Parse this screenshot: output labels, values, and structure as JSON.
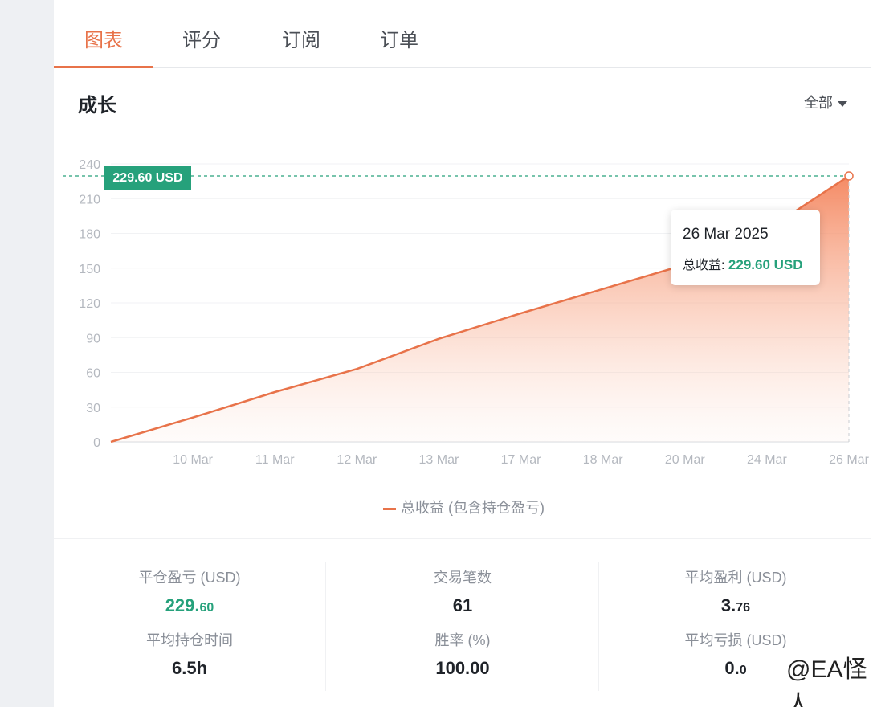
{
  "tabs": [
    {
      "label": "图表",
      "active": true
    },
    {
      "label": "评分",
      "active": false
    },
    {
      "label": "订阅",
      "active": false
    },
    {
      "label": "订单",
      "active": false
    }
  ],
  "section": {
    "title": "成长",
    "filter_label": "全部"
  },
  "current_value_badge": "229.60 USD",
  "tooltip": {
    "date": "26 Mar 2025",
    "label": "总收益:",
    "value": "229.60 USD"
  },
  "chart_data": {
    "type": "area",
    "categories": [
      "",
      "10 Mar",
      "11 Mar",
      "12 Mar",
      "13 Mar",
      "17 Mar",
      "18 Mar",
      "20 Mar",
      "24 Mar",
      "26 Mar"
    ],
    "series": [
      {
        "name": "总收益 (包含持仓盈亏)",
        "values": [
          0,
          21,
          43,
          63,
          89,
          111,
          132,
          153,
          183,
          229.6
        ]
      }
    ],
    "y_ticks": [
      0,
      30,
      60,
      90,
      120,
      150,
      180,
      210,
      240
    ],
    "ylim": [
      0,
      240
    ],
    "grid": true,
    "legend": "bottom-center",
    "colors": {
      "line": "#e8734a",
      "marker_line": "#26a17b"
    }
  },
  "stats": [
    {
      "label": "平仓盈亏 (USD)",
      "value_main": "229.",
      "value_small": "60",
      "color": "green"
    },
    {
      "label": "交易笔数",
      "value_main": "61",
      "value_small": ""
    },
    {
      "label": "平均盈利 (USD)",
      "value_main": "3.",
      "value_small": "76"
    },
    {
      "label": "平均持仓时间",
      "value_main": "6.5h",
      "value_small": ""
    },
    {
      "label": "胜率 (%)",
      "value_main": "100.00",
      "value_small": ""
    },
    {
      "label": "平均亏损 (USD)",
      "value_main": "0.",
      "value_small": "0"
    }
  ],
  "watermark": "@EA怪人"
}
